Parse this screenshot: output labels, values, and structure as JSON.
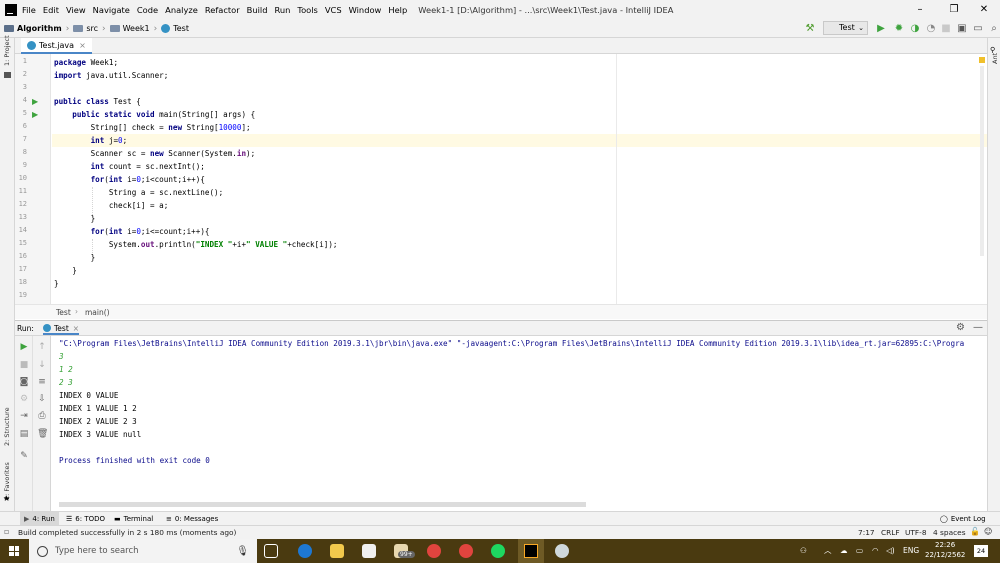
{
  "window": {
    "title": "Week1-1 [D:\\Algorithm] - ...\\src\\Week1\\Test.java - IntelliJ IDEA",
    "menu": [
      "File",
      "Edit",
      "View",
      "Navigate",
      "Code",
      "Analyze",
      "Refactor",
      "Build",
      "Run",
      "Tools",
      "VCS",
      "Window",
      "Help"
    ],
    "controls": {
      "minimize": "–",
      "restore": "❐",
      "close": "✕"
    }
  },
  "navbar": {
    "crumbs": [
      "Algorithm",
      "src",
      "Week1",
      "Test"
    ],
    "run_config": "Test"
  },
  "side_tools": {
    "left_top": "1: Project",
    "left_mid": "2: Structure",
    "left_bottom": "2: Favorites",
    "right": "Ant"
  },
  "editor_tab": {
    "label": "Test.java",
    "close": "×"
  },
  "code": {
    "line_numbers": [
      "1",
      "2",
      "3",
      "4",
      "5",
      "6",
      "7",
      "8",
      "9",
      "10",
      "11",
      "12",
      "13",
      "14",
      "15",
      "16",
      "17",
      "18",
      "19"
    ],
    "l1": {
      "kw": "package",
      "rest": " Week1;"
    },
    "l2": {
      "kw": "import",
      "rest": " java.util.Scanner;"
    },
    "l4": {
      "kw": "public class",
      "rest": " Test {"
    },
    "l5": {
      "indent": "    ",
      "kw": "public static void",
      "rest": " main(String[] args) {"
    },
    "l6": {
      "a": "        String[] check = ",
      "kw": "new",
      "b": " String[",
      "num": "10000",
      "c": "];"
    },
    "l7": {
      "a": "        ",
      "kw": "int",
      "b": " j=",
      "num": "0",
      "c": ";"
    },
    "l8": {
      "a": "        Scanner sc = ",
      "kw": "new",
      "b": " Scanner(System.",
      "fld": "in",
      "c": ");"
    },
    "l9": {
      "a": "        ",
      "kw": "int",
      "b": " count = sc.nextInt();"
    },
    "l10": {
      "a": "        ",
      "kw": "for",
      "b": "(",
      "kw2": "int",
      "c": " i=",
      "num": "0",
      "d": ";i<count;i++){"
    },
    "l11": {
      "a": "            String a = sc.nextLine();"
    },
    "l12": {
      "a": "            check[i] = a;"
    },
    "l13": {
      "a": "        }"
    },
    "l14": {
      "a": "        ",
      "kw": "for",
      "b": "(",
      "kw2": "int",
      "c": " i=",
      "num": "0",
      "d": ";i<=count;i++){"
    },
    "l15": {
      "a": "            System.",
      "fld": "out",
      "b": ".println(",
      "s1": "\"INDEX \"",
      "c": "+i+",
      "s2": "\" VALUE \"",
      "d": "+check[i]);"
    },
    "l16": {
      "a": "        }"
    },
    "l17": {
      "a": "    }"
    },
    "l18": {
      "a": "}"
    },
    "breadcrumb": [
      "Test",
      "main()"
    ]
  },
  "run_panel": {
    "label": "Run:",
    "tab": "Test",
    "cmd": "\"C:\\Program Files\\JetBrains\\IntelliJ IDEA Community Edition 2019.3.1\\jbr\\bin\\java.exe\" \"-javaagent:C:\\Program Files\\JetBrains\\IntelliJ IDEA Community Edition 2019.3.1\\lib\\idea_rt.jar=62895:C:\\Progra",
    "input": [
      "3",
      "1 2",
      "2 3"
    ],
    "output": [
      "INDEX 0 VALUE",
      "INDEX 1 VALUE 1 2",
      "INDEX 2 VALUE 2 3",
      "INDEX 3 VALUE null"
    ],
    "finish": "Process finished with exit code 0"
  },
  "bottom_tabs": {
    "run": "4: Run",
    "todo": "6: TODO",
    "terminal": "Terminal",
    "messages": "0: Messages",
    "event_log": "Event Log"
  },
  "status": {
    "message": "Build completed successfully in 2 s 180 ms (moments ago)",
    "position": "7:17",
    "line_sep": "CRLF",
    "encoding": "UTF-8",
    "indent": "4 spaces"
  },
  "taskbar": {
    "search_placeholder": "Type here to search",
    "badge": "99+",
    "lang": "ENG",
    "time": "22:26",
    "date": "22/12/2562",
    "notif": "24"
  },
  "colors": {
    "keyword": "#000080",
    "string": "#008000",
    "number": "#0000ff",
    "field": "#660e7a",
    "console_input": "#2f9e2f",
    "console_cmd": "#0b0b8b",
    "current_line": "#fffae3"
  }
}
